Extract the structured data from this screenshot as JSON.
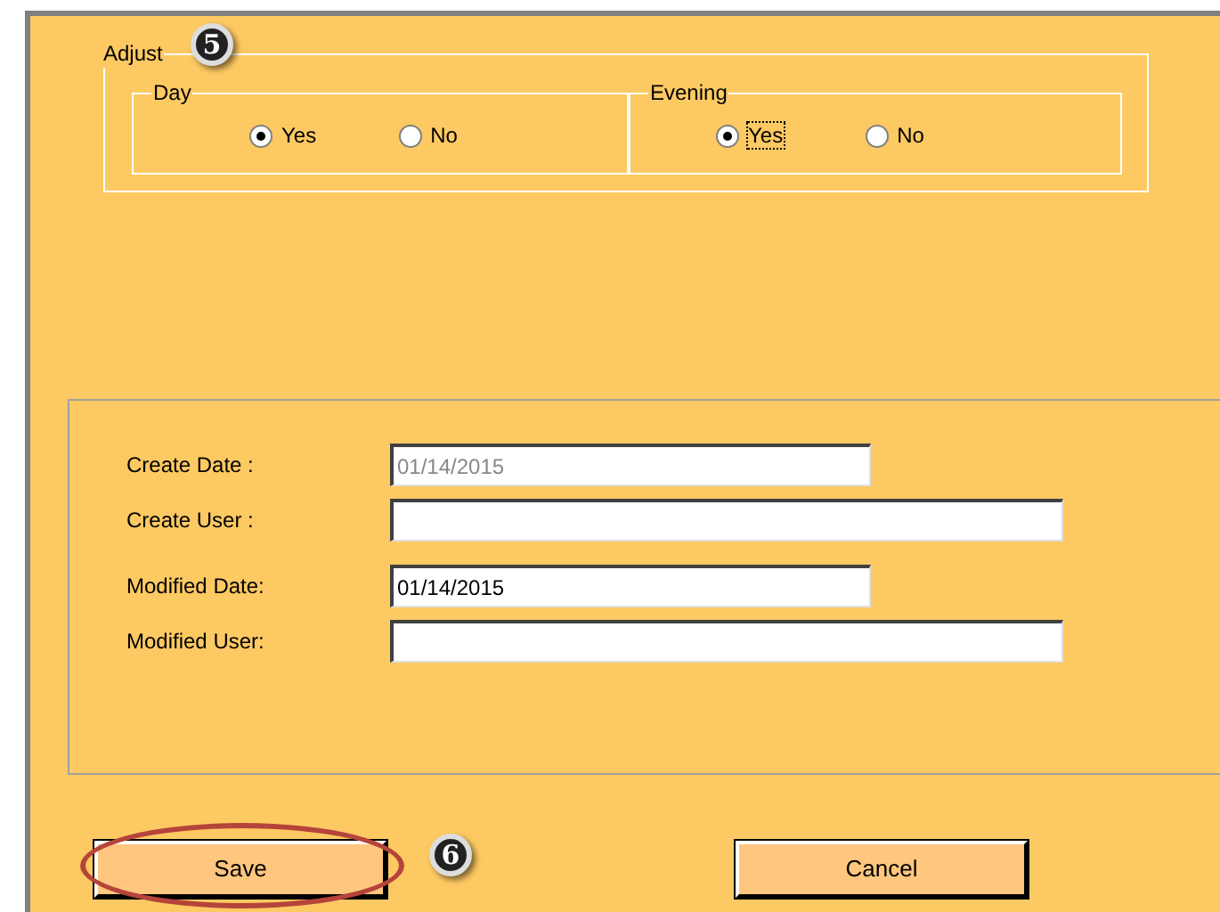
{
  "adjust": {
    "title": "Adjust",
    "callout": "5",
    "groups": [
      {
        "title": "Day",
        "options": [
          {
            "label": "Yes",
            "selected": true,
            "focused": false
          },
          {
            "label": "No",
            "selected": false,
            "focused": false
          }
        ]
      },
      {
        "title": "Evening",
        "options": [
          {
            "label": "Yes",
            "selected": true,
            "focused": true
          },
          {
            "label": "No",
            "selected": false,
            "focused": false
          }
        ]
      }
    ]
  },
  "fields": [
    {
      "label": "Create Date :",
      "value": "01/14/2015",
      "disabled": true,
      "wide": false
    },
    {
      "label": "Create User :",
      "disabled": false,
      "wide": true
    },
    {
      "label": "Modified Date:",
      "value": "01/14/2015",
      "disabled": false,
      "wide": false
    },
    {
      "label": "Modified User:",
      "disabled": false,
      "wide": true
    }
  ],
  "buttons": [
    {
      "label": "Save",
      "highlighted": true,
      "callout": "6"
    },
    {
      "label": "Cancel",
      "highlighted": false
    }
  ]
}
